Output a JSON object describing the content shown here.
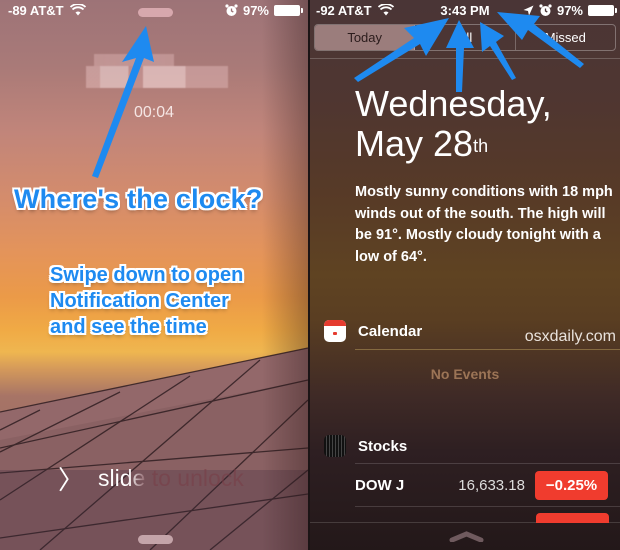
{
  "lock_screen": {
    "status": {
      "signal": "-89 AT&T",
      "battery": "97%",
      "icons": [
        "wifi-icon",
        "alarm-icon",
        "battery-icon"
      ]
    },
    "call_timer": "00:04",
    "caller_name": "(pixelated)",
    "slide_to_unlock": "slide to unlock"
  },
  "annotations": {
    "title": "Where's the clock?",
    "body_lines": [
      "Swipe down to open",
      "Notification Center",
      "and see the time"
    ]
  },
  "notification_center": {
    "status": {
      "signal": "-92 AT&T",
      "time": "3:43 PM",
      "battery": "97%",
      "icons": [
        "wifi-icon",
        "location-icon",
        "alarm-icon",
        "battery-icon"
      ]
    },
    "tabs": [
      {
        "label": "Today",
        "active": true
      },
      {
        "label": "All",
        "active": false
      },
      {
        "label": "Missed",
        "active": false
      }
    ],
    "date": {
      "line1": "Wednesday,",
      "line2": "May 28",
      "suffix": "th"
    },
    "weather_summary": "Mostly sunny conditions with 18 mph winds out of the south. The high will be 91°. Mostly cloudy tonight with a low of 64°.",
    "calendar": {
      "title": "Calendar",
      "empty_text": "No Events"
    },
    "watermark": "osxdaily.com",
    "stocks": {
      "title": "Stocks",
      "rows": [
        {
          "name": "DOW J",
          "price": "16,633.18",
          "change": "−0.25%",
          "change_color": "#f03c2e"
        }
      ]
    }
  },
  "colors": {
    "arrow": "#1e8af0",
    "stock_down": "#f03c2e",
    "active_tab": "#9b7d7c"
  }
}
